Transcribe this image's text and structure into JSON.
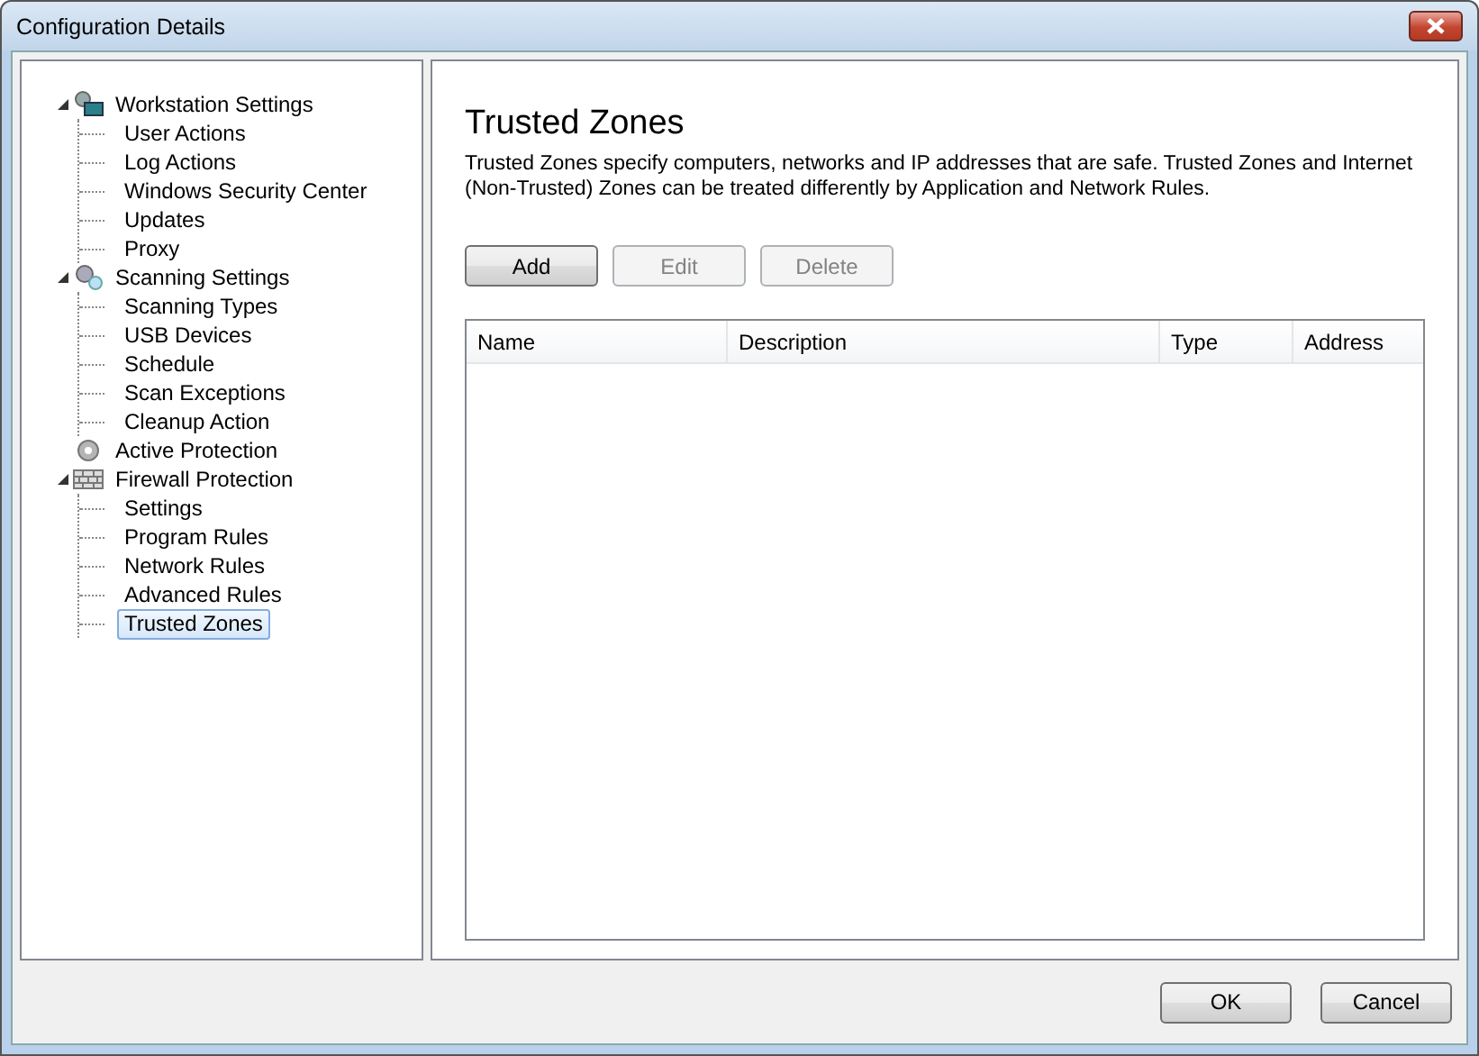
{
  "window": {
    "title": "Configuration Details"
  },
  "tree": [
    {
      "label": "Workstation Settings",
      "kind": "workstation",
      "expanded": true,
      "selected": false,
      "children": [
        {
          "label": "User Actions",
          "selected": false
        },
        {
          "label": "Log Actions",
          "selected": false
        },
        {
          "label": "Windows Security Center",
          "selected": false
        },
        {
          "label": "Updates",
          "selected": false
        },
        {
          "label": "Proxy",
          "selected": false
        }
      ]
    },
    {
      "label": "Scanning Settings",
      "kind": "scanning",
      "expanded": true,
      "selected": false,
      "children": [
        {
          "label": "Scanning Types",
          "selected": false
        },
        {
          "label": "USB Devices",
          "selected": false
        },
        {
          "label": "Schedule",
          "selected": false
        },
        {
          "label": "Scan Exceptions",
          "selected": false
        },
        {
          "label": "Cleanup Action",
          "selected": false
        }
      ]
    },
    {
      "label": "Active Protection",
      "kind": "protection",
      "selected": false
    },
    {
      "label": "Firewall Protection",
      "kind": "firewall",
      "expanded": true,
      "selected": false,
      "children": [
        {
          "label": "Settings",
          "selected": false
        },
        {
          "label": "Program Rules",
          "selected": false
        },
        {
          "label": "Network Rules",
          "selected": false
        },
        {
          "label": "Advanced Rules",
          "selected": false
        },
        {
          "label": "Trusted Zones",
          "selected": true
        }
      ]
    }
  ],
  "page": {
    "title": "Trusted Zones",
    "description": "Trusted Zones specify computers, networks and IP addresses that are safe. Trusted Zones and Internet (Non-Trusted) Zones can be treated differently by Application and Network Rules."
  },
  "actions": [
    {
      "label": "Add",
      "disabled": false
    },
    {
      "label": "Edit",
      "disabled": true
    },
    {
      "label": "Delete",
      "disabled": true
    }
  ],
  "table": {
    "columns": [
      "Name",
      "Description",
      "Type",
      "Address"
    ]
  },
  "buttons": [
    "OK",
    "Cancel"
  ]
}
